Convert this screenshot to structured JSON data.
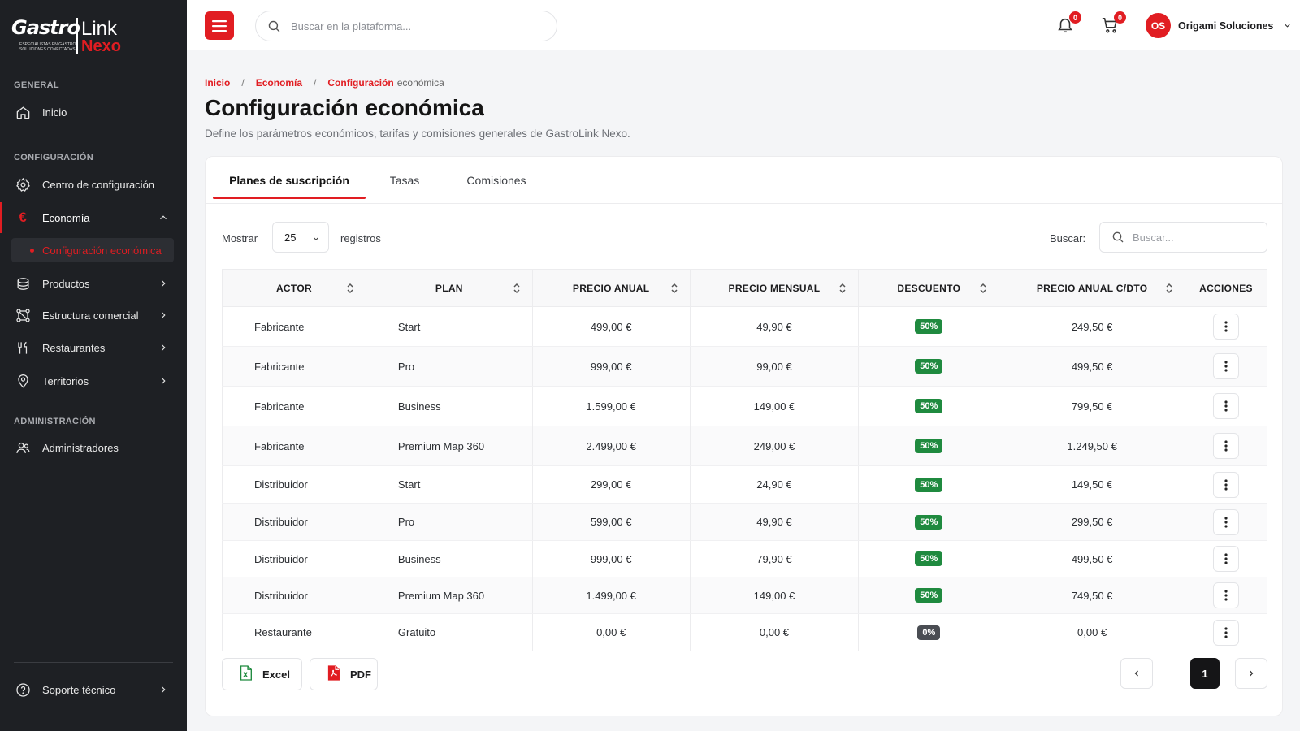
{
  "brand": {
    "name_part1": "Gastro",
    "name_part2": "Link",
    "name_part3": "Nexo",
    "tagline": "ESPECIALISTAS EN GASTRO SOLUCIONES CONECTADAS",
    "accent": "#e11d22"
  },
  "sidebar": {
    "general_title": "GENERAL",
    "config_title": "CONFIGURACIÓN",
    "admin_title": "ADMINISTRACIÓN",
    "items": {
      "inicio": "Inicio",
      "centro": "Centro de configuración",
      "economia": "Economía",
      "config_economica": "Configuración económica",
      "productos": "Productos",
      "estructura": "Estructura comercial",
      "restaurantes": "Restaurantes",
      "territorios": "Territorios",
      "administradores": "Administradores",
      "soporte": "Soporte técnico"
    }
  },
  "topbar": {
    "search_placeholder": "Buscar en la plataforma...",
    "notifications_count": "0",
    "cart_count": "0",
    "user_initials": "OS",
    "user_name": "Origami Soluciones"
  },
  "breadcrumb": {
    "home": "Inicio",
    "section": "Economía",
    "current_strong": "Configuración",
    "current_rest": "económica"
  },
  "page": {
    "title": "Configuración económica",
    "subtitle": "Define los parámetros económicos, tarifas y comisiones generales de GastroLink Nexo."
  },
  "tabs": [
    "Planes de suscripción",
    "Tasas",
    "Comisiones"
  ],
  "controls": {
    "show_label": "Mostrar",
    "page_size": "25",
    "records_label": "registros",
    "search_label": "Buscar:",
    "search_placeholder": "Buscar..."
  },
  "table": {
    "headers": [
      "ACTOR",
      "PLAN",
      "PRECIO ANUAL",
      "PRECIO MENSUAL",
      "DESCUENTO",
      "PRECIO ANUAL C/DTO",
      "ACCIONES"
    ],
    "rows": [
      {
        "actor": "Fabricante",
        "plan": "Start",
        "anual": "499,00 €",
        "mensual": "49,90 €",
        "descuento": "50%",
        "anual_dto": "249,50 €"
      },
      {
        "actor": "Fabricante",
        "plan": "Pro",
        "anual": "999,00 €",
        "mensual": "99,00 €",
        "descuento": "50%",
        "anual_dto": "499,50 €"
      },
      {
        "actor": "Fabricante",
        "plan": "Business",
        "anual": "1.599,00 €",
        "mensual": "149,00 €",
        "descuento": "50%",
        "anual_dto": "799,50 €"
      },
      {
        "actor": "Fabricante",
        "plan": "Premium Map 360",
        "anual": "2.499,00 €",
        "mensual": "249,00 €",
        "descuento": "50%",
        "anual_dto": "1.249,50 €"
      },
      {
        "actor": "Distribuidor",
        "plan": "Start",
        "anual": "299,00 €",
        "mensual": "24,90 €",
        "descuento": "50%",
        "anual_dto": "149,50 €"
      },
      {
        "actor": "Distribuidor",
        "plan": "Pro",
        "anual": "599,00 €",
        "mensual": "49,90 €",
        "descuento": "50%",
        "anual_dto": "299,50 €"
      },
      {
        "actor": "Distribuidor",
        "plan": "Business",
        "anual": "999,00 €",
        "mensual": "79,90 €",
        "descuento": "50%",
        "anual_dto": "499,50 €"
      },
      {
        "actor": "Distribuidor",
        "plan": "Premium Map 360",
        "anual": "1.499,00 €",
        "mensual": "149,00 €",
        "descuento": "50%",
        "anual_dto": "749,50 €"
      },
      {
        "actor": "Restaurante",
        "plan": "Gratuito",
        "anual": "0,00 €",
        "mensual": "0,00 €",
        "descuento": "0%",
        "anual_dto": "0,00 €"
      }
    ]
  },
  "export": {
    "excel": "Excel",
    "pdf": "PDF"
  },
  "pagination": {
    "current": "1"
  }
}
